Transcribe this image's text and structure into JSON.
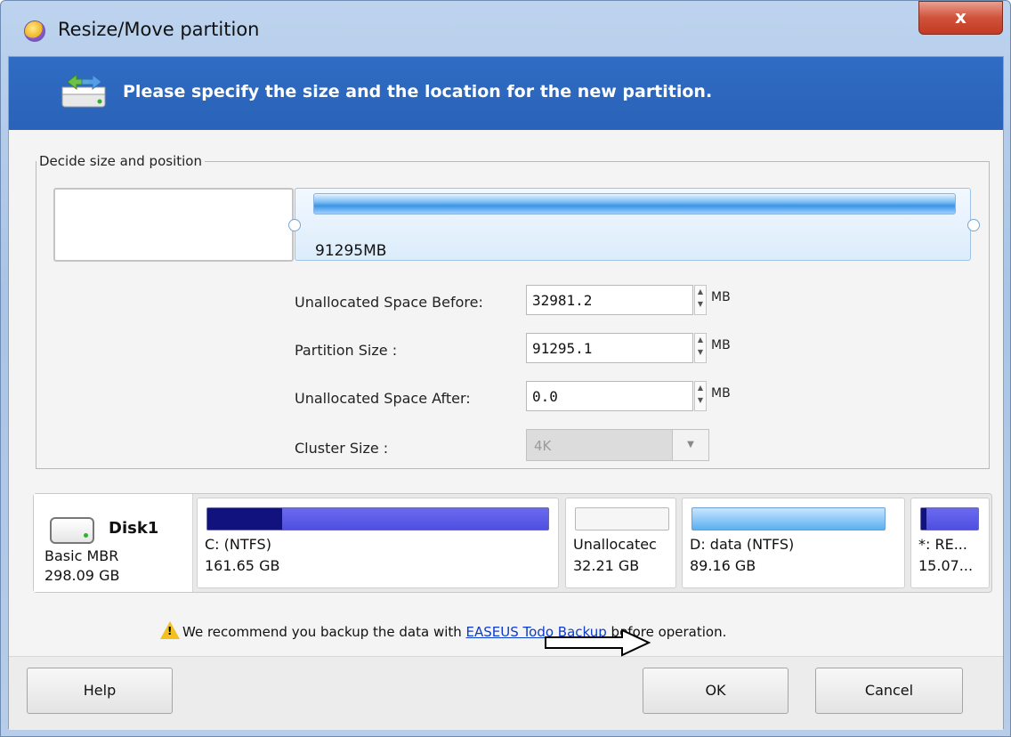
{
  "window": {
    "title": "Resize/Move partition",
    "close_label": "x"
  },
  "banner": {
    "text": "Please specify the size and the location for the new partition."
  },
  "group": {
    "legend": "Decide size and position",
    "map_label": "91295MB",
    "fields": [
      {
        "label": "Unallocated Space Before:",
        "value": "32981.2",
        "unit": "MB"
      },
      {
        "label": "Partition Size :",
        "value": "91295.1",
        "unit": "MB"
      },
      {
        "label": "Unallocated Space After:",
        "value": "0.0",
        "unit": "MB"
      }
    ],
    "cluster": {
      "label": "Cluster Size :",
      "value": "4K"
    }
  },
  "disk": {
    "name": "Disk1",
    "type": "Basic MBR",
    "size": "298.09 GB",
    "partitions": [
      {
        "name": "C: (NTFS)",
        "size": "161.65 GB",
        "used_fraction": 0.22
      },
      {
        "name": "Unallocatec",
        "size": "32.21 GB",
        "used_fraction": 0
      },
      {
        "name": "D: data (NTFS)",
        "size": "89.16 GB",
        "used_fraction": 0
      },
      {
        "name": "*: RE...",
        "size": "15.07...",
        "used_fraction": 0.1
      }
    ]
  },
  "warning": {
    "prefix": "We recommend you backup the data with ",
    "link": "EASEUS Todo Backup",
    "suffix": " before operation."
  },
  "buttons": {
    "help": "Help",
    "ok": "OK",
    "cancel": "Cancel"
  },
  "colors": {
    "banner": "#2f6cc3",
    "used_bar": "#1a1a8c",
    "free_bar": "#4f7fd8",
    "link": "#0b3bcc"
  }
}
